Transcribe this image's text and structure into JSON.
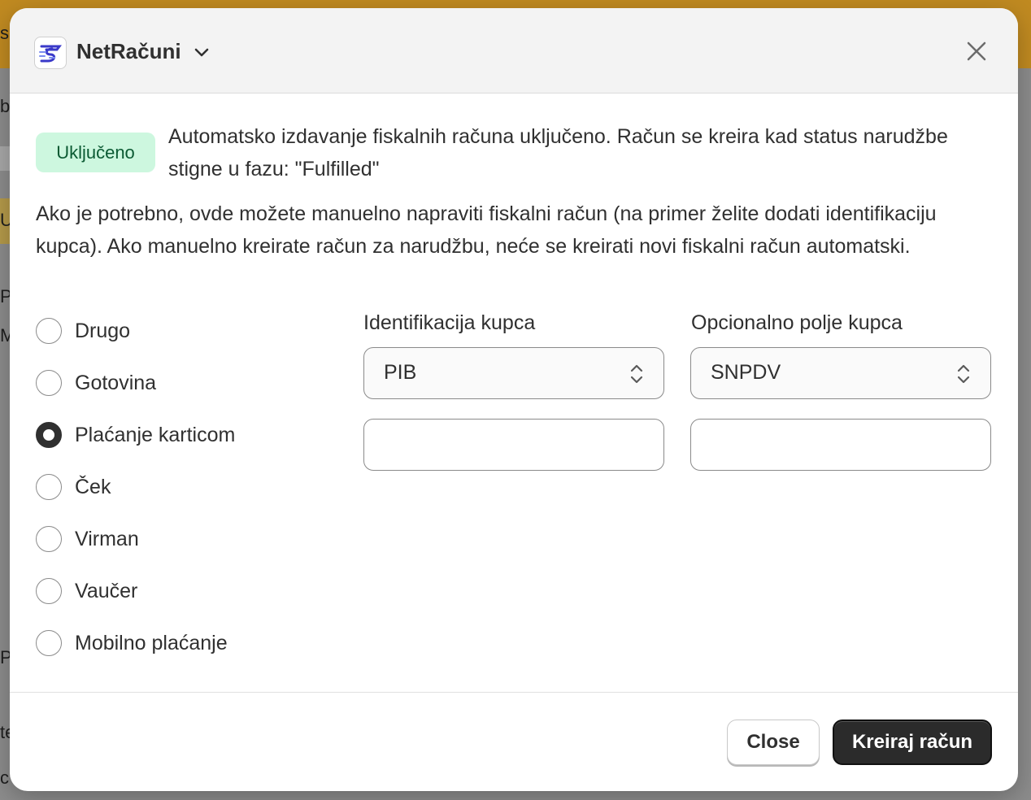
{
  "backdrop": {
    "letters": [
      "s",
      "ba",
      "Ur",
      "P",
      "M",
      "Pa",
      "te",
      "co"
    ]
  },
  "header": {
    "app_name": "NetRačuni",
    "logo_icon": "netracuni-logo-icon",
    "close_icon": "close-icon"
  },
  "status": {
    "badge": "Uključeno",
    "badge_color": "#cdf7df",
    "message": "Automatsko izdavanje fiskalnih računa uključeno. Račun se kreira kad status narudžbe stigne u fazu: \"Fulfilled\""
  },
  "info": "Ako je potrebno, ovde možete manuelno napraviti fiskalni račun (na primer želite dodati identifikaciju kupca). Ako manuelno kreirate račun za narudžbu, neće se kreirati novi fiskalni račun automatski.",
  "payment_methods": {
    "options": [
      "Drugo",
      "Gotovina",
      "Plaćanje karticom",
      "Ček",
      "Virman",
      "Vaučer",
      "Mobilno plaćanje"
    ],
    "selected": "Plaćanje karticom"
  },
  "buyer_id": {
    "label": "Identifikacija kupca",
    "selected": "PIB",
    "input_value": ""
  },
  "optional_field": {
    "label": "Opcionalno polje kupca",
    "selected": "SNPDV",
    "input_value": ""
  },
  "footer": {
    "close_label": "Close",
    "create_label": "Kreiraj račun"
  }
}
